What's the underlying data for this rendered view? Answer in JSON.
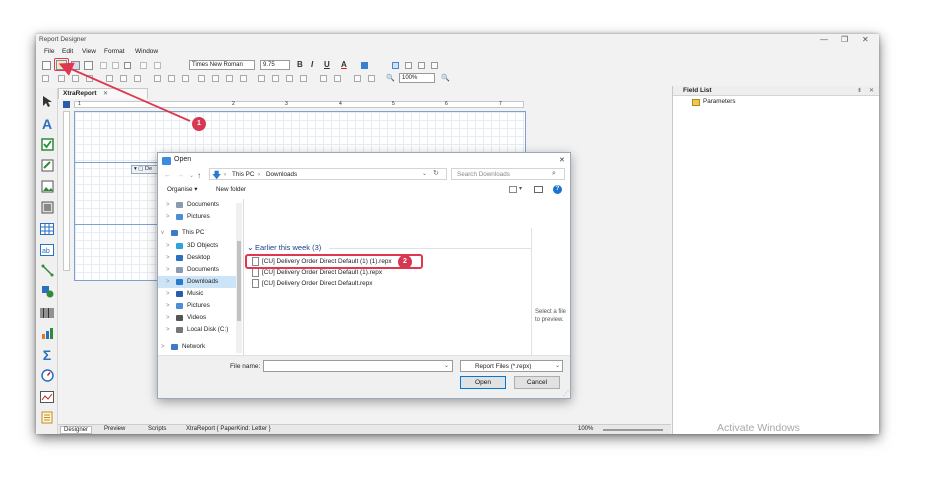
{
  "window": {
    "title": "Report Designer",
    "minimize": "—",
    "restore": "❐",
    "close": "✕"
  },
  "menu": [
    "File",
    "Edit",
    "View",
    "Format",
    "Window"
  ],
  "toolbar": {
    "font_name": "Times New Roman",
    "font_size": "9.75",
    "bold": "B",
    "italic": "I",
    "underline": "U",
    "font_color": "A",
    "zoom": "100%"
  },
  "doc_tab": {
    "label": "XtraReport",
    "close": "✕"
  },
  "ruler_numbers": [
    "1",
    "2",
    "3",
    "4",
    "5",
    "6",
    "7"
  ],
  "band_label": "De",
  "status_tabs": {
    "designer": "Designer",
    "preview": "Preview",
    "scripts": "Scripts",
    "report_info": "XtraReport { PaperKind: Letter }",
    "zoom": "100%"
  },
  "field_list": {
    "title": "Field List",
    "pin": "⇟",
    "close": "✕",
    "item": "Parameters"
  },
  "dialog": {
    "title": "Open",
    "close": "✕",
    "path": {
      "root": "This PC",
      "sep": "›",
      "folder": "Downloads"
    },
    "search_placeholder": "Search Downloads",
    "organise": "Organise ▾",
    "new_folder": "New folder",
    "group_header": "Earlier this week (3)",
    "files": [
      "[CU] Delivery Order Direct Default (1) (1).repx",
      "[CU] Delivery Order Direct Default (1).repx",
      "[CU] Delivery Order Direct Default.repx"
    ],
    "preview_text": "Select a file to preview.",
    "nav": [
      {
        "label": "Documents",
        "chev": ">",
        "color": "#8a9bb0"
      },
      {
        "label": "Pictures",
        "chev": ">",
        "color": "#4a8fd6"
      },
      {
        "label": "This PC",
        "chev": "v",
        "color": "#3c7bc8"
      },
      {
        "label": "3D Objects",
        "chev": ">",
        "color": "#2fa3d8"
      },
      {
        "label": "Desktop",
        "chev": ">",
        "color": "#2f6fbf"
      },
      {
        "label": "Documents",
        "chev": ">",
        "color": "#8a9bb0"
      },
      {
        "label": "Downloads",
        "chev": ">",
        "color": "#2a78d0"
      },
      {
        "label": "Music",
        "chev": ">",
        "color": "#2a5da8"
      },
      {
        "label": "Pictures",
        "chev": ">",
        "color": "#4a8fd6"
      },
      {
        "label": "Videos",
        "chev": ">",
        "color": "#555555"
      },
      {
        "label": "Local Disk (C:)",
        "chev": ">",
        "color": "#777777"
      },
      {
        "label": "Network",
        "chev": ">",
        "color": "#3c7bc8"
      }
    ],
    "file_name_label": "File name:",
    "file_type": "Report Files (*.repx)",
    "open_button": "Open",
    "cancel_button": "Cancel"
  },
  "callouts": [
    "1",
    "2"
  ],
  "watermark": "Activate Windows",
  "colors": {
    "accent": "#0078d7",
    "callout": "#d73851",
    "highlight_box": "#e0364f",
    "selection": "#cce4f7",
    "page_border": "#7da2ce"
  }
}
